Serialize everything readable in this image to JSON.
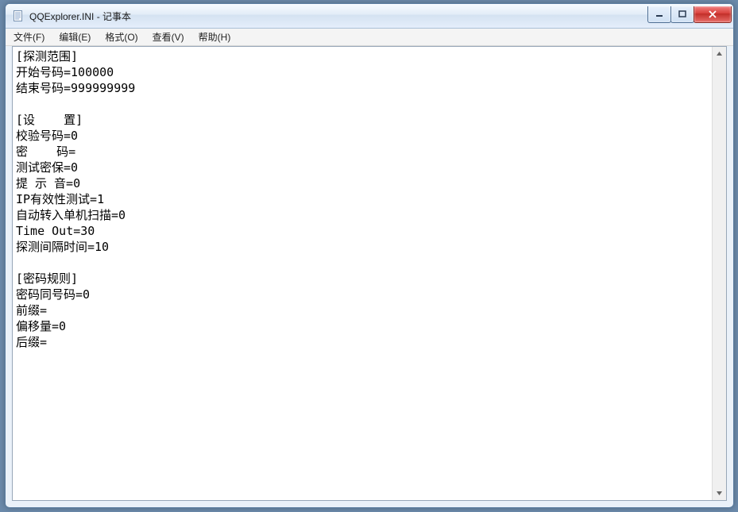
{
  "window": {
    "title": "QQExplorer.INI - 记事本"
  },
  "menu": {
    "file": "文件(F)",
    "edit": "编辑(E)",
    "format": "格式(O)",
    "view": "查看(V)",
    "help": "帮助(H)"
  },
  "content": "[探测范围]\n开始号码=100000\n结束号码=999999999\n\n[设    置]\n校验号码=0\n密    码=\n测试密保=0\n提 示 音=0\nIP有效性测试=1\n自动转入单机扫描=0\nTime Out=30\n探测间隔时间=10\n\n[密码规则]\n密码同号码=0\n前缀=\n偏移量=0\n后缀="
}
